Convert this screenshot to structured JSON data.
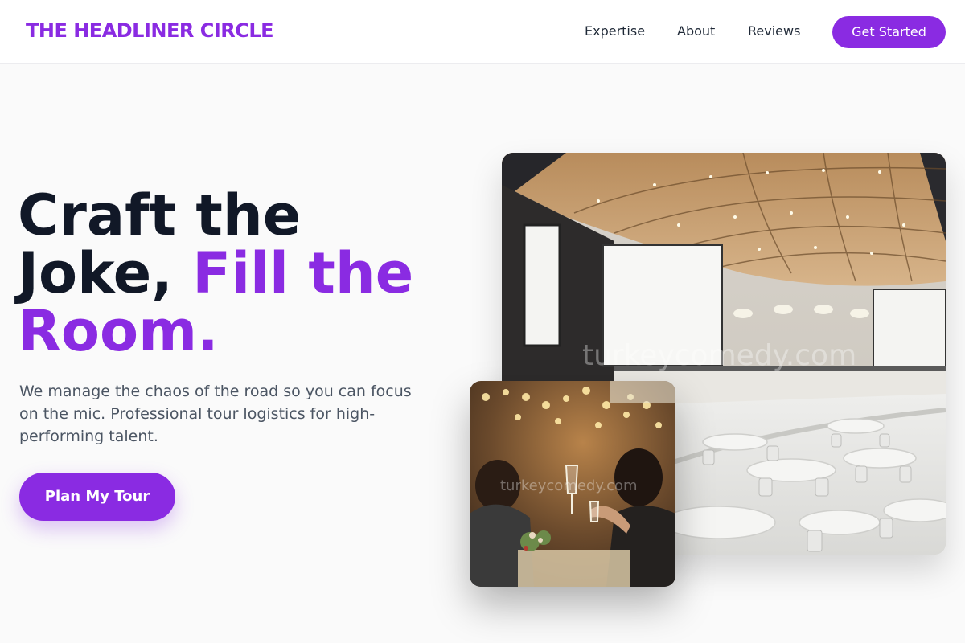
{
  "brand": {
    "name": "THE HEADLINER CIRCLE"
  },
  "nav": {
    "links": [
      "Expertise",
      "About",
      "Reviews"
    ],
    "cta": "Get Started"
  },
  "hero": {
    "headline_line1": "Craft the",
    "headline_line2_plain": "Joke, ",
    "headline_line2_accent": "Fill the",
    "headline_line3_accent": "Room.",
    "subtitle": "We manage the chaos of the road so you can focus on the mic. Professional tour logistics for high-performing talent.",
    "cta": "Plan My Tour"
  },
  "images": {
    "main_watermark": "turkeycomedy.com",
    "small_watermark": "turkeycomedy.com"
  },
  "colors": {
    "accent": "#8a2be2",
    "heading": "#111827",
    "body_text": "#4b5563"
  }
}
